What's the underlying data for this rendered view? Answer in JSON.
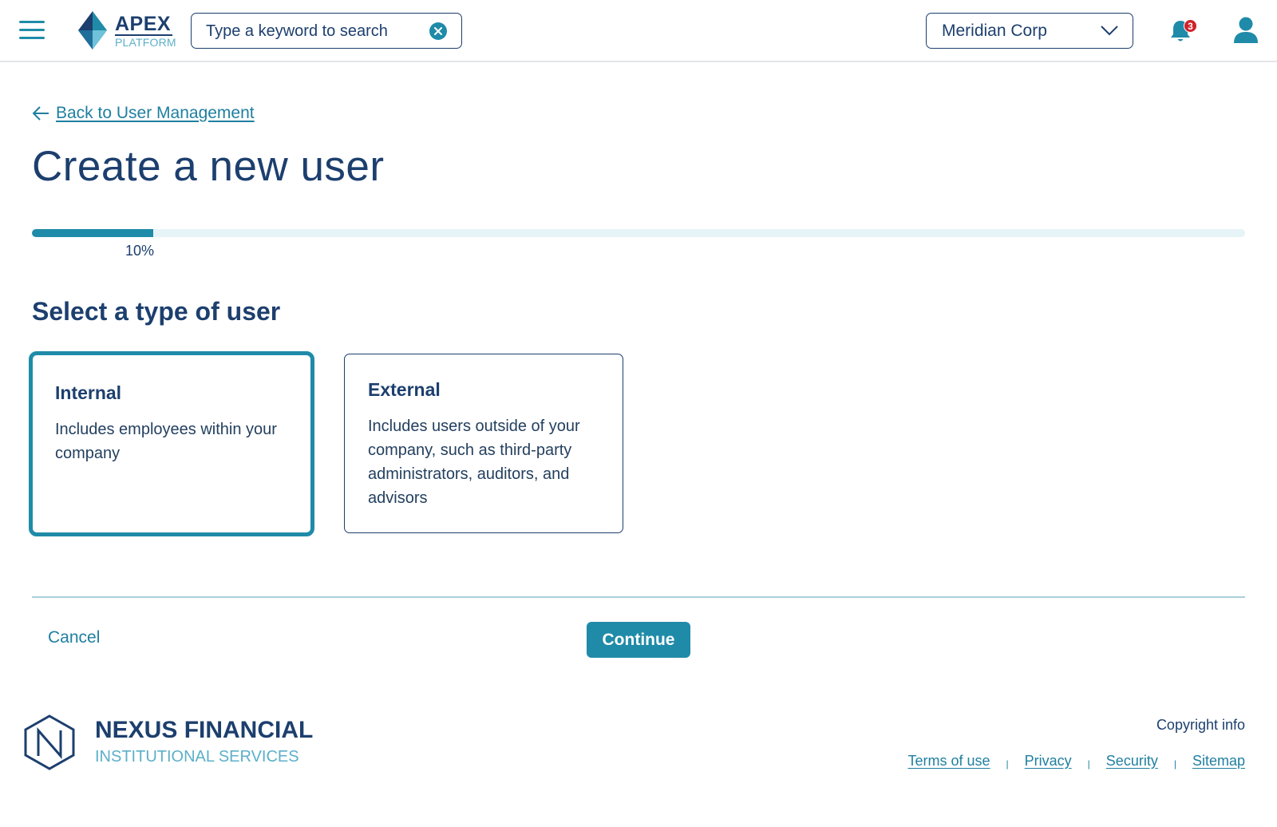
{
  "header": {
    "logo": {
      "title": "APEX",
      "subtitle": "PLATFORM"
    },
    "search": {
      "placeholder": "Type a keyword to search"
    },
    "org_selector": {
      "selected": "Meridian Corp"
    },
    "notifications": {
      "count": "3"
    }
  },
  "main": {
    "back_link": "Back to User Management",
    "page_title": "Create a new user",
    "progress": {
      "value": 0.1,
      "label": "10%"
    },
    "section_title": "Select a type of user",
    "options": [
      {
        "title": "Internal",
        "description": "Includes employees within your company",
        "selected": true
      },
      {
        "title": "External",
        "description": "Includes users outside of your company, such as third-party administrators, auditors, and advisors",
        "selected": false
      }
    ],
    "actions": {
      "cancel": "Cancel",
      "continue": "Continue"
    }
  },
  "footer": {
    "brand": "NEXUS FINANCIAL",
    "brand_sub": "INSTITUTIONAL SERVICES",
    "copyright": "Copyright info",
    "links": [
      "Terms of use",
      "Privacy",
      "Security",
      "Sitemap"
    ]
  },
  "colors": {
    "primary": "#1c3f6e",
    "accent": "#1f8ba8",
    "accent_light": "#5cb0c9",
    "badge": "#d0222a"
  },
  "icons": {
    "menu": "hamburger-icon",
    "clear": "clear-circle-icon",
    "chevron": "chevron-down-icon",
    "notifications": "bell-icon",
    "account": "user-icon",
    "back": "arrow-left-icon"
  }
}
